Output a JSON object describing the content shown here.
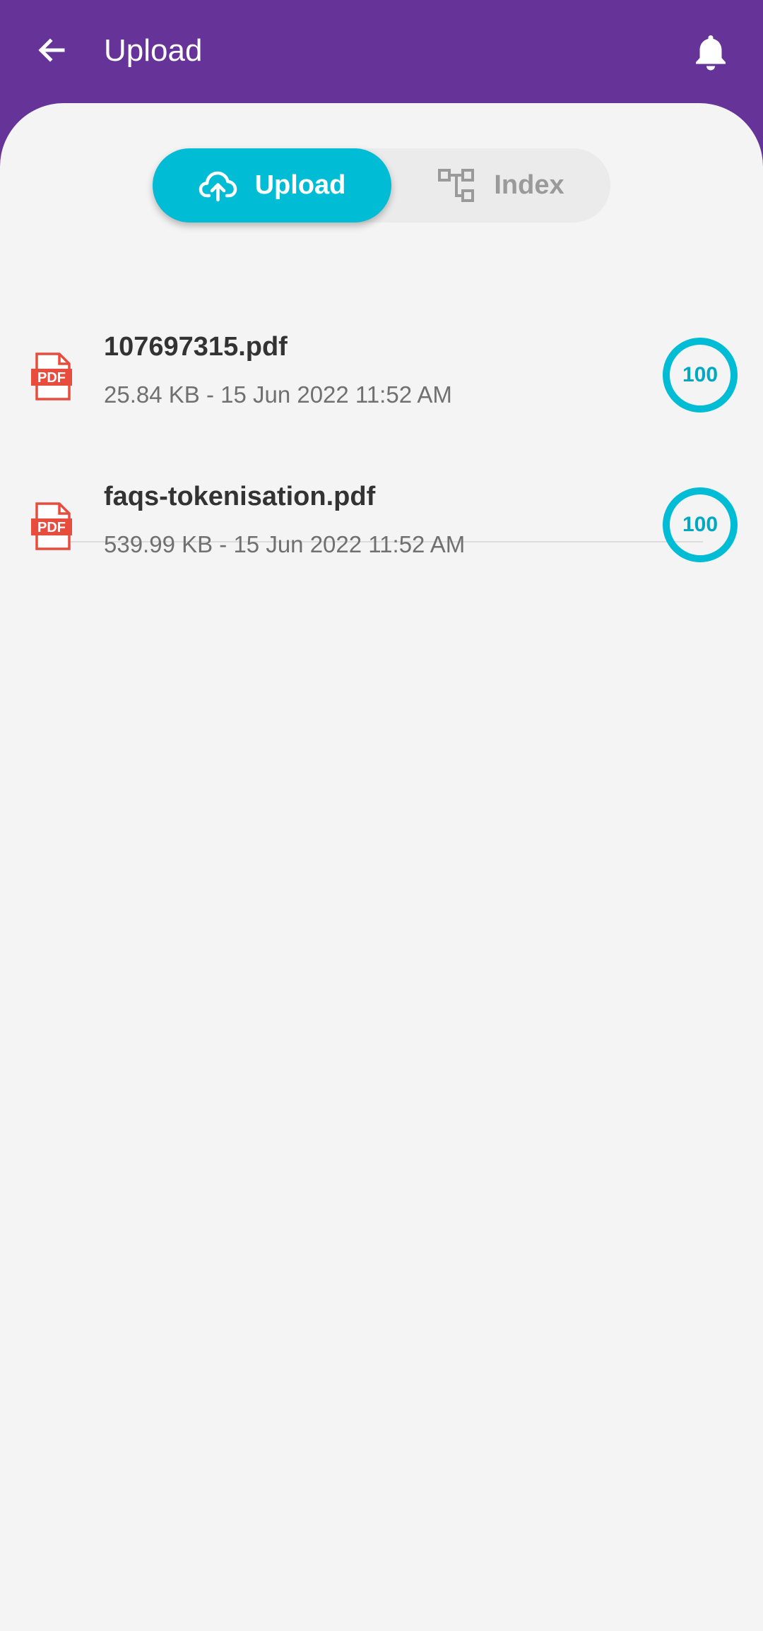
{
  "appbar": {
    "title": "Upload",
    "back_icon": "arrow-left-icon",
    "bell_icon": "bell-icon",
    "bg_color": "#663399"
  },
  "tabs": [
    {
      "label": "Upload",
      "icon": "cloud-upload-icon",
      "active": true
    },
    {
      "label": "Index",
      "icon": "hierarchy-icon",
      "active": false
    }
  ],
  "accent_color": "#00bcd4",
  "files": [
    {
      "name": "107697315.pdf",
      "meta": "25.84 KB - 15 Jun 2022 11:52 AM",
      "progress": "100",
      "icon": "pdf-file-icon"
    },
    {
      "name": "faqs-tokenisation.pdf",
      "meta": "539.99 KB - 15 Jun 2022 11:52 AM",
      "progress": "100",
      "icon": "pdf-file-icon"
    }
  ]
}
